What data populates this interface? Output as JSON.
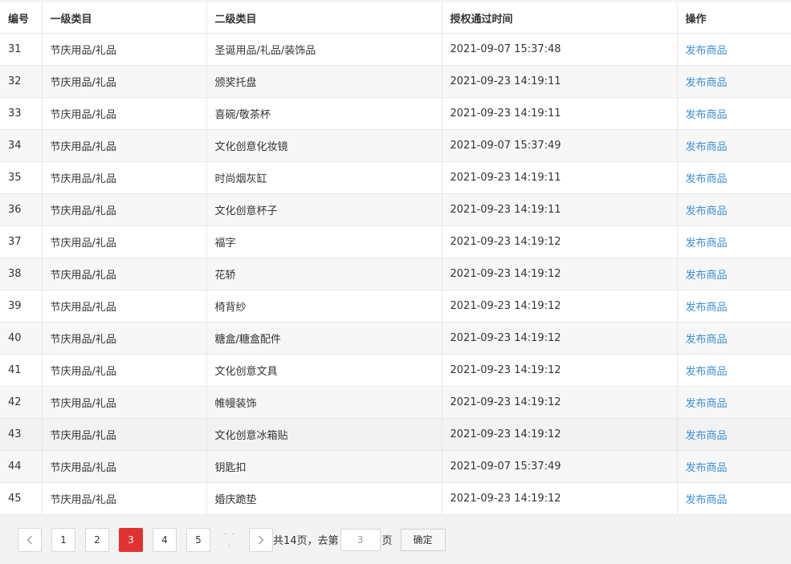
{
  "table": {
    "headers": [
      "编号",
      "一级类目",
      "二级类目",
      "授权通过时间",
      "操作"
    ],
    "rows": [
      {
        "id": "31",
        "cat1": "节庆用品/礼品",
        "cat2": "圣诞用品/礼品/装饰品",
        "time": "2021-09-07 15:37:48",
        "action": "发布商品"
      },
      {
        "id": "32",
        "cat1": "节庆用品/礼品",
        "cat2": "颁奖托盘",
        "time": "2021-09-23 14:19:11",
        "action": "发布商品"
      },
      {
        "id": "33",
        "cat1": "节庆用品/礼品",
        "cat2": "喜碗/敬茶杯",
        "time": "2021-09-23 14:19:11",
        "action": "发布商品"
      },
      {
        "id": "34",
        "cat1": "节庆用品/礼品",
        "cat2": "文化创意化妆镜",
        "time": "2021-09-07 15:37:49",
        "action": "发布商品"
      },
      {
        "id": "35",
        "cat1": "节庆用品/礼品",
        "cat2": "时尚烟灰缸",
        "time": "2021-09-23 14:19:11",
        "action": "发布商品"
      },
      {
        "id": "36",
        "cat1": "节庆用品/礼品",
        "cat2": "文化创意杯子",
        "time": "2021-09-23 14:19:11",
        "action": "发布商品"
      },
      {
        "id": "37",
        "cat1": "节庆用品/礼品",
        "cat2": "福字",
        "time": "2021-09-23 14:19:12",
        "action": "发布商品"
      },
      {
        "id": "38",
        "cat1": "节庆用品/礼品",
        "cat2": "花轿",
        "time": "2021-09-23 14:19:12",
        "action": "发布商品"
      },
      {
        "id": "39",
        "cat1": "节庆用品/礼品",
        "cat2": "椅背纱",
        "time": "2021-09-23 14:19:12",
        "action": "发布商品"
      },
      {
        "id": "40",
        "cat1": "节庆用品/礼品",
        "cat2": "糖盒/糖盒配件",
        "time": "2021-09-23 14:19:12",
        "action": "发布商品"
      },
      {
        "id": "41",
        "cat1": "节庆用品/礼品",
        "cat2": "文化创意文具",
        "time": "2021-09-23 14:19:12",
        "action": "发布商品"
      },
      {
        "id": "42",
        "cat1": "节庆用品/礼品",
        "cat2": "帷幔装饰",
        "time": "2021-09-23 14:19:12",
        "action": "发布商品"
      },
      {
        "id": "43",
        "cat1": "节庆用品/礼品",
        "cat2": "文化创意冰箱贴",
        "time": "2021-09-23 14:19:12",
        "action": "发布商品"
      },
      {
        "id": "44",
        "cat1": "节庆用品/礼品",
        "cat2": "钥匙扣",
        "time": "2021-09-07 15:37:49",
        "action": "发布商品"
      },
      {
        "id": "45",
        "cat1": "节庆用品/礼品",
        "cat2": "婚庆跪垫",
        "time": "2021-09-23 14:19:12",
        "action": "发布商品"
      }
    ]
  },
  "pagination": {
    "pages": [
      "1",
      "2",
      "3",
      "4",
      "5"
    ],
    "current": "3",
    "ellipsis": "· · ·",
    "total_text": "共14页，去第",
    "page_input_value": "3",
    "page_suffix": "页",
    "confirm_label": "确定",
    "prev_icon": "chevron-left-icon",
    "next_icon": "chevron-right-icon"
  },
  "colors": {
    "link": "#3b8fd6",
    "active_page": "#e0332f"
  }
}
